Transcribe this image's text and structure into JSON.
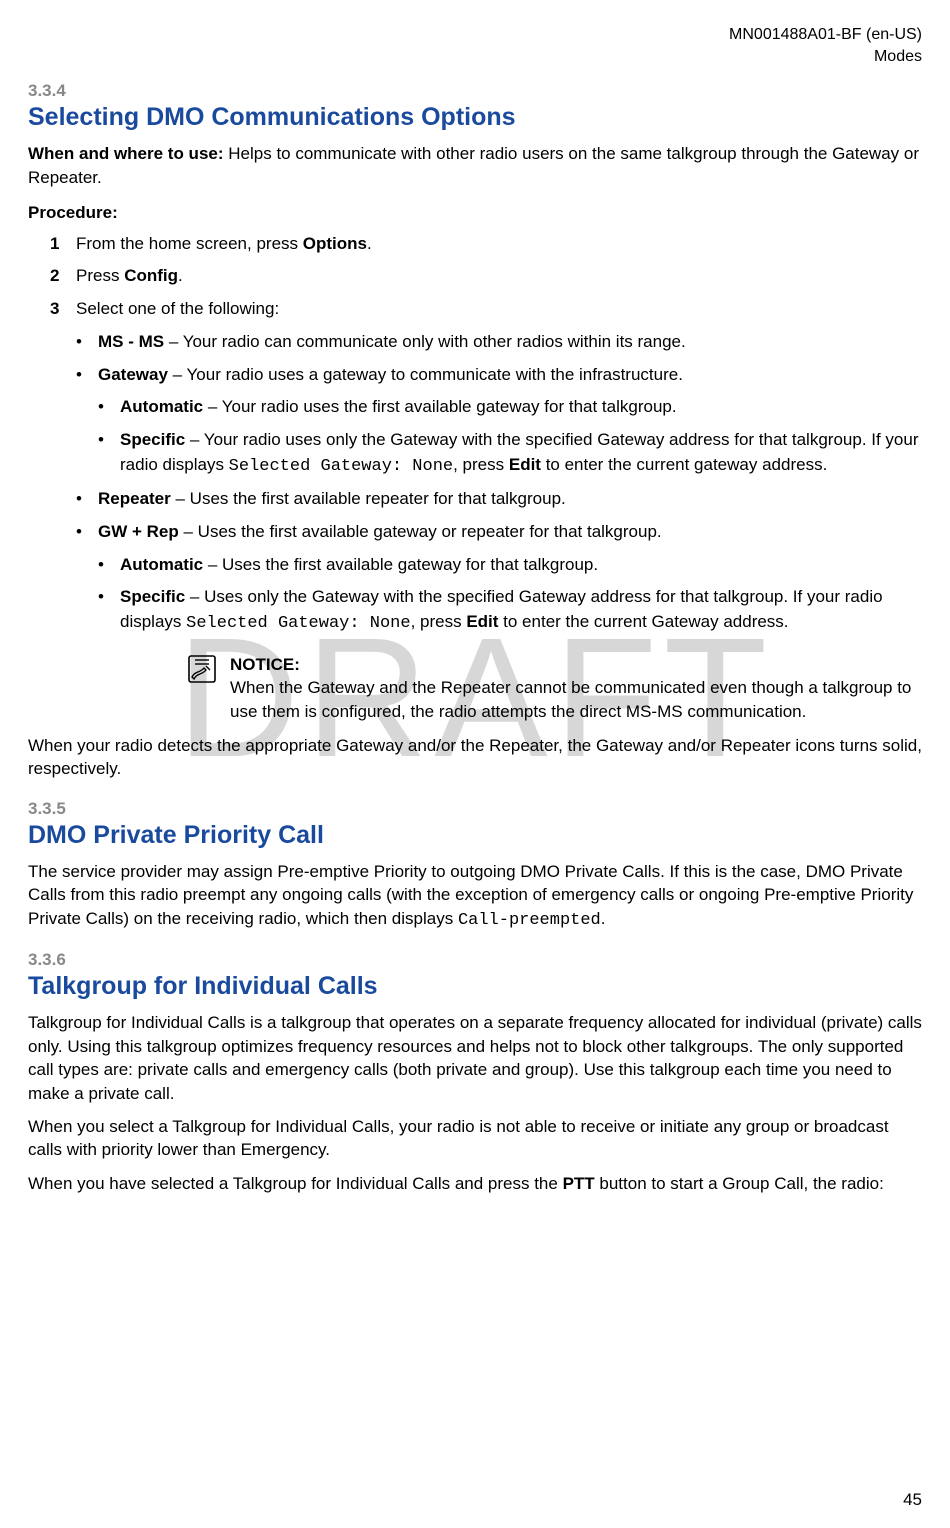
{
  "header": {
    "doc_id": "MN001488A01-BF (en-US)",
    "chapter": "Modes"
  },
  "watermark": "DRAFT",
  "page_num": "45",
  "s334": {
    "num": "3.3.4",
    "title": "Selecting DMO Communications Options",
    "when_label": "When and where to use:",
    "when_text": " Helps to communicate with other radio users on the same talkgroup through the Gateway or Repeater.",
    "procedure_label": "Procedure:",
    "step1_pre": "From the home screen, press ",
    "step1_b": "Options",
    "step1_post": ".",
    "step2_pre": "Press ",
    "step2_b": "Config",
    "step2_post": ".",
    "step3": "Select one of the following:",
    "msms_b": "MS - MS",
    "msms_t": " – Your radio can communicate only with other radios within its range.",
    "gateway_b": "Gateway",
    "gateway_t": " – Your radio uses a gateway to communicate with the infrastructure.",
    "gw_auto_b": "Automatic",
    "gw_auto_t": " – Your radio uses the first available gateway for that talkgroup.",
    "gw_spec_b": "Specific",
    "gw_spec_t1": " – Your radio uses only the Gateway with the specified Gateway address for that talkgroup. If your radio displays ",
    "gw_spec_mono": "Selected Gateway: None",
    "gw_spec_t2": ", press ",
    "gw_spec_edit": "Edit",
    "gw_spec_t3": " to enter the current gateway address.",
    "repeater_b": "Repeater",
    "repeater_t": " – Uses the first available repeater for that talkgroup.",
    "gwrep_b": "GW + Rep",
    "gwrep_t": " – Uses the first available gateway or repeater for that talkgroup.",
    "gr_auto_b": "Automatic",
    "gr_auto_t": " – Uses the first available gateway for that talkgroup.",
    "gr_spec_b": "Specific",
    "gr_spec_t1": " – Uses only the Gateway with the specified Gateway address for that talkgroup. If your radio displays ",
    "gr_spec_mono": "Selected Gateway: None",
    "gr_spec_t2": ", press ",
    "gr_spec_edit": "Edit",
    "gr_spec_t3": " to enter the current Gateway address.",
    "notice_label": "NOTICE:",
    "notice_text": "When the Gateway and the Repeater cannot be communicated even though a talkgroup to use them is configured, the radio attempts the direct MS-MS communication.",
    "result": "When your radio detects the appropriate Gateway and/or the Repeater, the Gateway and/or Repeater icons turns solid, respectively."
  },
  "s335": {
    "num": "3.3.5",
    "title": "DMO Private Priority Call",
    "p1_a": "The service provider may assign Pre-emptive Priority to outgoing DMO Private Calls. If this is the case, DMO Private Calls from this radio preempt any ongoing calls (with the exception of emergency calls or ongoing Pre-emptive Priority Private Calls) on the receiving radio, which then displays ",
    "p1_mono": "Call-preempted",
    "p1_b": "."
  },
  "s336": {
    "num": "3.3.6",
    "title": "Talkgroup for Individual Calls",
    "p1": "Talkgroup for Individual Calls is a talkgroup that operates on a separate frequency allocated for individual (private) calls only. Using this talkgroup optimizes frequency resources and helps not to block other talkgroups. The only supported call types are: private calls and emergency calls (both private and group). Use this talkgroup each time you need to make a private call.",
    "p2": "When you select a Talkgroup for Individual Calls, your radio is not able to receive or initiate any group or broadcast calls with priority lower than Emergency.",
    "p3_a": "When you have selected a Talkgroup for Individual Calls and press the ",
    "p3_b": "PTT",
    "p3_c": " button to start a Group Call, the radio:"
  }
}
